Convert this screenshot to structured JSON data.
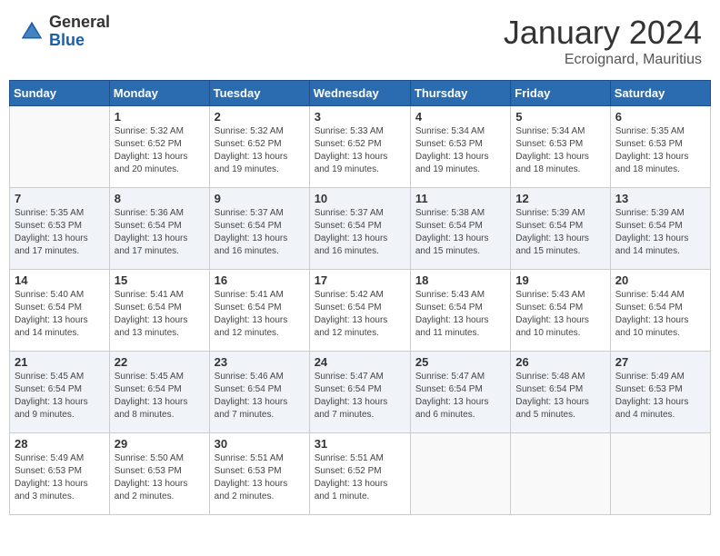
{
  "header": {
    "logo": {
      "general": "General",
      "blue": "Blue"
    },
    "title": "January 2024",
    "location": "Ecroignard, Mauritius"
  },
  "weekdays": [
    "Sunday",
    "Monday",
    "Tuesday",
    "Wednesday",
    "Thursday",
    "Friday",
    "Saturday"
  ],
  "weeks": [
    [
      {
        "day": "",
        "info": ""
      },
      {
        "day": "1",
        "info": "Sunrise: 5:32 AM\nSunset: 6:52 PM\nDaylight: 13 hours\nand 20 minutes."
      },
      {
        "day": "2",
        "info": "Sunrise: 5:32 AM\nSunset: 6:52 PM\nDaylight: 13 hours\nand 19 minutes."
      },
      {
        "day": "3",
        "info": "Sunrise: 5:33 AM\nSunset: 6:52 PM\nDaylight: 13 hours\nand 19 minutes."
      },
      {
        "day": "4",
        "info": "Sunrise: 5:34 AM\nSunset: 6:53 PM\nDaylight: 13 hours\nand 19 minutes."
      },
      {
        "day": "5",
        "info": "Sunrise: 5:34 AM\nSunset: 6:53 PM\nDaylight: 13 hours\nand 18 minutes."
      },
      {
        "day": "6",
        "info": "Sunrise: 5:35 AM\nSunset: 6:53 PM\nDaylight: 13 hours\nand 18 minutes."
      }
    ],
    [
      {
        "day": "7",
        "info": "Sunrise: 5:35 AM\nSunset: 6:53 PM\nDaylight: 13 hours\nand 17 minutes."
      },
      {
        "day": "8",
        "info": "Sunrise: 5:36 AM\nSunset: 6:54 PM\nDaylight: 13 hours\nand 17 minutes."
      },
      {
        "day": "9",
        "info": "Sunrise: 5:37 AM\nSunset: 6:54 PM\nDaylight: 13 hours\nand 16 minutes."
      },
      {
        "day": "10",
        "info": "Sunrise: 5:37 AM\nSunset: 6:54 PM\nDaylight: 13 hours\nand 16 minutes."
      },
      {
        "day": "11",
        "info": "Sunrise: 5:38 AM\nSunset: 6:54 PM\nDaylight: 13 hours\nand 15 minutes."
      },
      {
        "day": "12",
        "info": "Sunrise: 5:39 AM\nSunset: 6:54 PM\nDaylight: 13 hours\nand 15 minutes."
      },
      {
        "day": "13",
        "info": "Sunrise: 5:39 AM\nSunset: 6:54 PM\nDaylight: 13 hours\nand 14 minutes."
      }
    ],
    [
      {
        "day": "14",
        "info": "Sunrise: 5:40 AM\nSunset: 6:54 PM\nDaylight: 13 hours\nand 14 minutes."
      },
      {
        "day": "15",
        "info": "Sunrise: 5:41 AM\nSunset: 6:54 PM\nDaylight: 13 hours\nand 13 minutes."
      },
      {
        "day": "16",
        "info": "Sunrise: 5:41 AM\nSunset: 6:54 PM\nDaylight: 13 hours\nand 12 minutes."
      },
      {
        "day": "17",
        "info": "Sunrise: 5:42 AM\nSunset: 6:54 PM\nDaylight: 13 hours\nand 12 minutes."
      },
      {
        "day": "18",
        "info": "Sunrise: 5:43 AM\nSunset: 6:54 PM\nDaylight: 13 hours\nand 11 minutes."
      },
      {
        "day": "19",
        "info": "Sunrise: 5:43 AM\nSunset: 6:54 PM\nDaylight: 13 hours\nand 10 minutes."
      },
      {
        "day": "20",
        "info": "Sunrise: 5:44 AM\nSunset: 6:54 PM\nDaylight: 13 hours\nand 10 minutes."
      }
    ],
    [
      {
        "day": "21",
        "info": "Sunrise: 5:45 AM\nSunset: 6:54 PM\nDaylight: 13 hours\nand 9 minutes."
      },
      {
        "day": "22",
        "info": "Sunrise: 5:45 AM\nSunset: 6:54 PM\nDaylight: 13 hours\nand 8 minutes."
      },
      {
        "day": "23",
        "info": "Sunrise: 5:46 AM\nSunset: 6:54 PM\nDaylight: 13 hours\nand 7 minutes."
      },
      {
        "day": "24",
        "info": "Sunrise: 5:47 AM\nSunset: 6:54 PM\nDaylight: 13 hours\nand 7 minutes."
      },
      {
        "day": "25",
        "info": "Sunrise: 5:47 AM\nSunset: 6:54 PM\nDaylight: 13 hours\nand 6 minutes."
      },
      {
        "day": "26",
        "info": "Sunrise: 5:48 AM\nSunset: 6:54 PM\nDaylight: 13 hours\nand 5 minutes."
      },
      {
        "day": "27",
        "info": "Sunrise: 5:49 AM\nSunset: 6:53 PM\nDaylight: 13 hours\nand 4 minutes."
      }
    ],
    [
      {
        "day": "28",
        "info": "Sunrise: 5:49 AM\nSunset: 6:53 PM\nDaylight: 13 hours\nand 3 minutes."
      },
      {
        "day": "29",
        "info": "Sunrise: 5:50 AM\nSunset: 6:53 PM\nDaylight: 13 hours\nand 2 minutes."
      },
      {
        "day": "30",
        "info": "Sunrise: 5:51 AM\nSunset: 6:53 PM\nDaylight: 13 hours\nand 2 minutes."
      },
      {
        "day": "31",
        "info": "Sunrise: 5:51 AM\nSunset: 6:52 PM\nDaylight: 13 hours\nand 1 minute."
      },
      {
        "day": "",
        "info": ""
      },
      {
        "day": "",
        "info": ""
      },
      {
        "day": "",
        "info": ""
      }
    ]
  ]
}
